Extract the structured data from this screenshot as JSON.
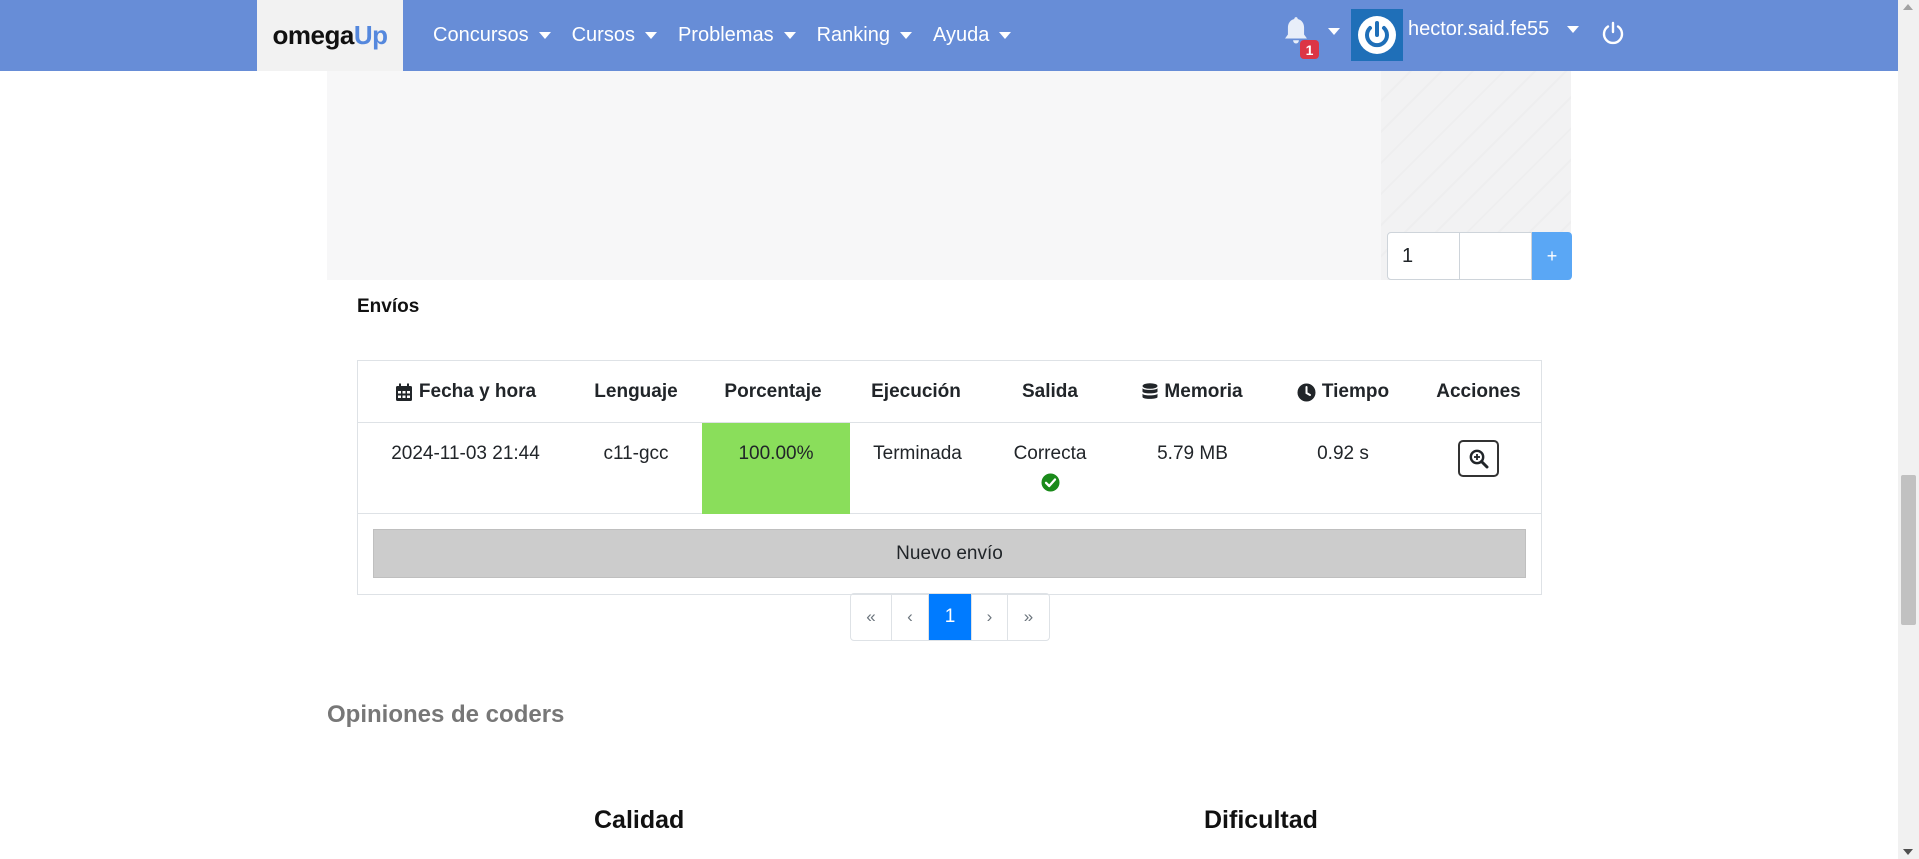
{
  "navbar": {
    "brand_part1": "omega",
    "brand_part2": "Up",
    "menu": [
      "Concursos",
      "Cursos",
      "Problemas",
      "Ranking",
      "Ayuda"
    ],
    "notification_count": "1",
    "username": "hector.said.fe55",
    "colors": {
      "background": "#678dd7",
      "badge": "#dc3545"
    }
  },
  "editor": {
    "case_number_value": "1",
    "add_button_label": "+"
  },
  "submissions": {
    "title": "Envíos",
    "columns": [
      "Fecha y hora",
      "Lenguaje",
      "Porcentaje",
      "Ejecución",
      "Salida",
      "Memoria",
      "Tiempo",
      "Acciones"
    ],
    "rows": [
      {
        "datetime": "2024-11-03 21:44",
        "language": "c11-gcc",
        "percentage": "100.00%",
        "execution": "Terminada",
        "output": "Correcta",
        "memory": "5.79 MB",
        "time": "0.92 s"
      }
    ],
    "new_submission_label": "Nuevo envío",
    "percentage_color": "#8ade5b"
  },
  "pagination": {
    "first": "«",
    "prev": "‹",
    "current": "1",
    "next": "›",
    "last": "»"
  },
  "opinions": {
    "title": "Opiniones de coders",
    "quality_label": "Calidad",
    "difficulty_label": "Dificultad"
  }
}
